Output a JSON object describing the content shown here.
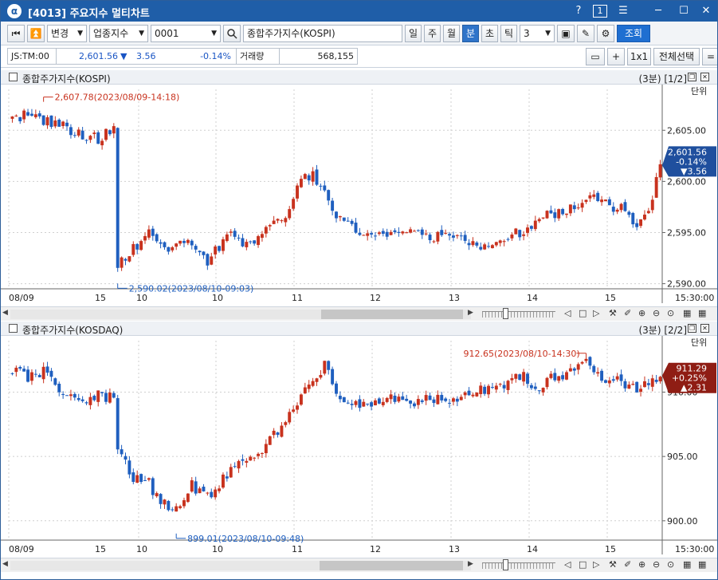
{
  "window": {
    "title": "[4013] 주요지수 멀티차트",
    "help": "?",
    "page_box": "1"
  },
  "toolbar": {
    "change_label": "변경",
    "category_label": "업종지수",
    "code_value": "0001",
    "name_value": "종합주가지수(KOSPI)",
    "period_tabs": [
      "일",
      "주",
      "월",
      "분",
      "초",
      "틱"
    ],
    "active_period": "분",
    "interval_value": "3",
    "query_label": "조회"
  },
  "quote": {
    "time": "JS:TM:00",
    "price": "2,601.56",
    "change": "3.56",
    "pct": "-0.14%",
    "volume_label": "거래량",
    "volume": "568,155",
    "btn_plus": "+",
    "btn_1x1": "1x1",
    "btn_select_all": "전체선택",
    "btn_more": "="
  },
  "panels": [
    {
      "title": "종합주가지수(KOSPI)",
      "info": "(3분)  [1/2]",
      "axis_unit": "단위",
      "price_box": [
        "2,601.56",
        "-0.14%",
        "▼3.56"
      ],
      "box_color": "#1f4f9e",
      "high_label": "2,607.78(2023/08/09-14:18)",
      "low_label": "2,590.02(2023/08/10-09:03)"
    },
    {
      "title": "종합주가지수(KOSDAQ)",
      "info": "(3분)  [2/2]",
      "axis_unit": "단위",
      "price_box": [
        "911.29",
        "+0.25%",
        "▲2.31"
      ],
      "box_color": "#8f1d14",
      "high_label": "912.65(2023/08/10-14:30)",
      "low_label": "899.01(2023/08/10-09:48)"
    }
  ],
  "x_axis": {
    "labels": [
      "08/09",
      "15",
      "10",
      "10",
      "11",
      "12",
      "13",
      "14",
      "15",
      "15:30:00"
    ]
  },
  "colors": {
    "up": "#c8321e",
    "down": "#1f5fbf",
    "title_bar": "#1f5ea8"
  },
  "chart_data": [
    {
      "type": "candlestick",
      "title": "종합주가지수(KOSPI)",
      "interval": "3분",
      "ylim": [
        2589.5,
        2609.0
      ],
      "y_ticks": [
        2590.0,
        2595.0,
        2600.0,
        2605.0
      ],
      "y_tick_labels": [
        "2,590.00",
        "2,595.00",
        "2,600.00",
        "2,605.00"
      ],
      "x_tick_labels": [
        "08/09",
        "15",
        "10",
        "10",
        "11",
        "12",
        "13",
        "14",
        "15",
        "15:30:00"
      ],
      "high": 2607.78,
      "low": 2590.02,
      "last": 2601.56,
      "close_path": [
        [
          0,
          2606.2
        ],
        [
          4,
          2606.6
        ],
        [
          8,
          2606.0
        ],
        [
          13,
          2605.3
        ],
        [
          18,
          2604.6
        ],
        [
          22,
          2604.1
        ],
        [
          26,
          2605.4
        ],
        [
          27,
          2592.0
        ],
        [
          31,
          2593.5
        ],
        [
          35,
          2595.0
        ],
        [
          40,
          2593.0
        ],
        [
          45,
          2594.2
        ],
        [
          50,
          2592.1
        ],
        [
          55,
          2594.8
        ],
        [
          60,
          2593.7
        ],
        [
          65,
          2595.6
        ],
        [
          70,
          2596.8
        ],
        [
          74,
          2600.2
        ],
        [
          77,
          2600.8
        ],
        [
          80,
          2598.6
        ],
        [
          83,
          2596.4
        ],
        [
          87,
          2595.4
        ],
        [
          92,
          2594.9
        ],
        [
          97,
          2594.7
        ],
        [
          102,
          2595.2
        ],
        [
          107,
          2594.6
        ],
        [
          112,
          2595.0
        ],
        [
          117,
          2594.0
        ],
        [
          122,
          2593.4
        ],
        [
          127,
          2594.5
        ],
        [
          132,
          2595.4
        ],
        [
          137,
          2596.6
        ],
        [
          142,
          2597.0
        ],
        [
          147,
          2598.6
        ],
        [
          152,
          2597.7
        ],
        [
          157,
          2597.3
        ],
        [
          160,
          2595.2
        ],
        [
          164,
          2598.4
        ],
        [
          166,
          2601.6
        ]
      ]
    },
    {
      "type": "candlestick",
      "title": "종합주가지수(KOSDAQ)",
      "interval": "3분",
      "ylim": [
        898.5,
        914.0
      ],
      "y_ticks": [
        900.0,
        905.0,
        910.0
      ],
      "y_tick_labels": [
        "900.00",
        "905.00",
        "910.00"
      ],
      "x_tick_labels": [
        "08/09",
        "15",
        "10",
        "10",
        "11",
        "12",
        "13",
        "14",
        "15",
        "15:30:00"
      ],
      "high": 912.65,
      "low": 899.01,
      "last": 911.29,
      "close_path": [
        [
          0,
          911.6
        ],
        [
          4,
          911.2
        ],
        [
          8,
          911.7
        ],
        [
          11,
          910.6
        ],
        [
          14,
          909.8
        ],
        [
          18,
          909.5
        ],
        [
          22,
          909.7
        ],
        [
          26,
          909.6
        ],
        [
          27,
          905.6
        ],
        [
          31,
          903.2
        ],
        [
          35,
          903.0
        ],
        [
          38,
          901.3
        ],
        [
          42,
          901.0
        ],
        [
          46,
          902.8
        ],
        [
          50,
          901.8
        ],
        [
          55,
          903.6
        ],
        [
          60,
          904.8
        ],
        [
          65,
          905.9
        ],
        [
          70,
          907.8
        ],
        [
          74,
          909.6
        ],
        [
          78,
          911.0
        ],
        [
          80,
          912.2
        ],
        [
          83,
          909.6
        ],
        [
          87,
          909.3
        ],
        [
          92,
          908.9
        ],
        [
          97,
          909.4
        ],
        [
          102,
          909.0
        ],
        [
          107,
          909.5
        ],
        [
          112,
          909.3
        ],
        [
          117,
          910.0
        ],
        [
          122,
          910.3
        ],
        [
          127,
          910.8
        ],
        [
          131,
          911.4
        ],
        [
          134,
          910.0
        ],
        [
          138,
          911.0
        ],
        [
          142,
          911.4
        ],
        [
          147,
          912.3
        ],
        [
          150,
          911.2
        ],
        [
          155,
          911.0
        ],
        [
          160,
          910.2
        ],
        [
          164,
          910.9
        ],
        [
          166,
          911.3
        ]
      ]
    }
  ]
}
